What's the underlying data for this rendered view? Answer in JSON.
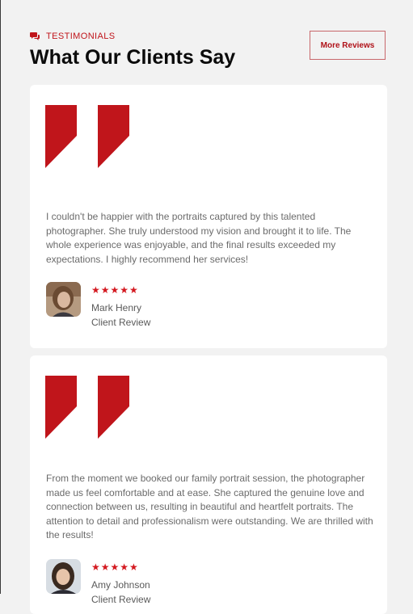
{
  "header": {
    "eyebrow": "TESTIMONIALS",
    "title": "What Our Clients Say",
    "more_button": "More Reviews"
  },
  "colors": {
    "accent": "#c0151b",
    "page_bg": "#f2f2f2",
    "card_bg": "#ffffff",
    "body_text": "#6b6b6b"
  },
  "testimonials": [
    {
      "quote": "I couldn't be happier with the portraits captured by this talented photographer. She truly understood my vision and brought it to life. The whole experience was enjoyable, and the final results exceeded my expectations. I highly recommend her services!",
      "rating": 5,
      "stars": "★★★★★",
      "name": "Mark Henry",
      "role": "Client Review"
    },
    {
      "quote": "From the moment we booked our family portrait session, the photographer made us feel comfortable and at ease. She captured the genuine love and connection between us, resulting in beautiful and heartfelt portraits. The attention to detail and professionalism were outstanding. We are thrilled with the results!",
      "rating": 5,
      "stars": "★★★★★",
      "name": "Amy Johnson",
      "role": "Client Review"
    }
  ],
  "icons": {
    "eyebrow": "chat-bubbles-icon",
    "quote": "quote-mark-icon",
    "star": "star-icon"
  }
}
